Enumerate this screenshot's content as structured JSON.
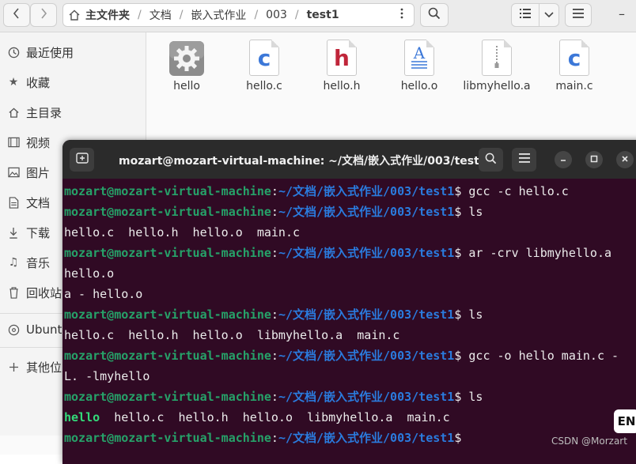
{
  "toolbar": {
    "back_icon": "chevron-left-icon",
    "forward_icon": "chevron-right-icon",
    "breadcrumb": [
      "主文件夹",
      "文档",
      "嵌入式作业",
      "003",
      "test1"
    ],
    "minimize": "–"
  },
  "sidebar": {
    "items": [
      {
        "label": "最近使用",
        "icon": "clock-icon"
      },
      {
        "label": "收藏",
        "icon": "star-icon"
      },
      {
        "label": "主目录",
        "icon": "home-icon"
      },
      {
        "label": "视频",
        "icon": "film-icon"
      },
      {
        "label": "图片",
        "icon": "image-icon"
      },
      {
        "label": "文档",
        "icon": "document-icon"
      },
      {
        "label": "下载",
        "icon": "download-icon"
      },
      {
        "label": "音乐",
        "icon": "music-icon"
      },
      {
        "label": "回收站",
        "icon": "trash-icon"
      },
      {
        "label": "Ubuntu",
        "icon": "disc-icon"
      },
      {
        "label": "其他位置",
        "icon": "plus-icon"
      }
    ]
  },
  "files": [
    {
      "name": "hello",
      "type": "executable"
    },
    {
      "name": "hello.c",
      "type": "c-source",
      "letter": "c",
      "color": "#3c78d8"
    },
    {
      "name": "hello.h",
      "type": "c-header",
      "letter": "h",
      "color": "#c0263a"
    },
    {
      "name": "hello.o",
      "type": "object",
      "letter": "A",
      "color": "#3c78d8"
    },
    {
      "name": "libmyhello.a",
      "type": "archive"
    },
    {
      "name": "main.c",
      "type": "c-source",
      "letter": "c",
      "color": "#3c78d8"
    }
  ],
  "terminal": {
    "title": "mozart@mozart-virtual-machine: ~/文档/嵌入式作业/003/test1",
    "user_host": "mozart@mozart-virtual-machine",
    "colon": ":",
    "path": "~/文档/嵌入式作业/003/test1",
    "lines": [
      {
        "kind": "prompt",
        "cmd": "$ gcc -c hello.c"
      },
      {
        "kind": "prompt",
        "cmd": "$ ls"
      },
      {
        "kind": "out",
        "text": "hello.c  hello.h  hello.o  main.c"
      },
      {
        "kind": "prompt",
        "cmd": "$ ar -crv libmyhello.a"
      },
      {
        "kind": "out",
        "text": "hello.o"
      },
      {
        "kind": "out",
        "text": "a - hello.o"
      },
      {
        "kind": "prompt",
        "cmd": "$ ls"
      },
      {
        "kind": "out",
        "text": "hello.c  hello.h  hello.o  libmyhello.a  main.c"
      },
      {
        "kind": "prompt",
        "cmd": "$ gcc -o hello main.c -"
      },
      {
        "kind": "out",
        "text": "L. -lmyhello"
      },
      {
        "kind": "prompt",
        "cmd": "$ ls"
      },
      {
        "kind": "out-exe",
        "exe": "hello",
        "text": "  hello.c  hello.h  hello.o  libmyhello.a  main.c"
      },
      {
        "kind": "prompt",
        "cmd": "$"
      }
    ]
  },
  "input_method": "EN",
  "watermark": "CSDN @Morzart",
  "colors": {
    "terminal_bg": "#300a24",
    "prompt_user": "#26a269",
    "prompt_path": "#2a7bde",
    "executable": "#33da7a"
  }
}
